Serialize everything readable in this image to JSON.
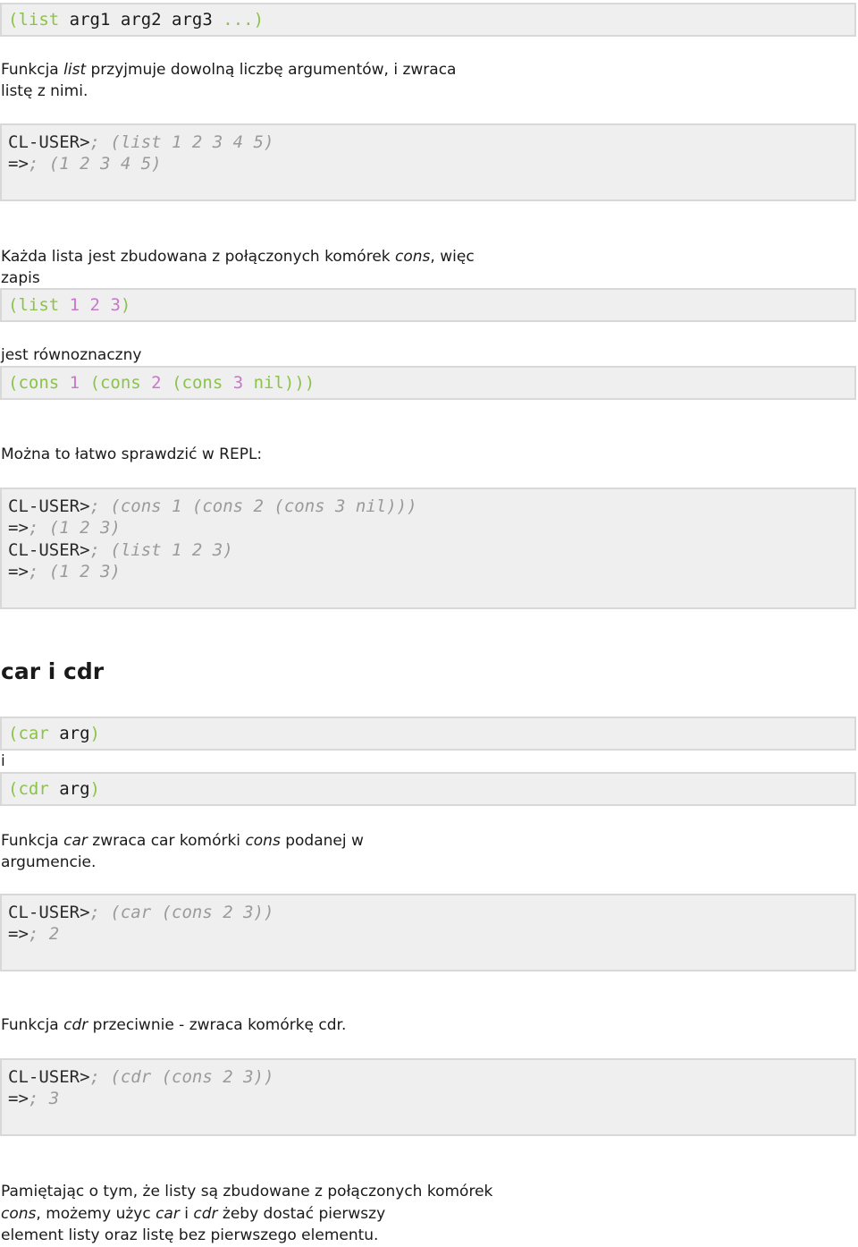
{
  "sig_list": {
    "open": "(",
    "fn": "list",
    "args": " arg1 arg2 arg3 ",
    "rest": "...",
    "close": ")"
  },
  "p1": {
    "a": "Funkcja ",
    "b": "list",
    "c": " przyjmuje dowolną liczbę argumentów, i zwraca",
    "d": "listę z nimi."
  },
  "repl1": {
    "prompt": "CL-USER>",
    "l1": "; (list 1 2 3 4 5)",
    "arrow": "=>",
    "l2": "; (1 2 3 4 5)"
  },
  "p2": {
    "a": "Każda lista jest zbudowana z połączonych komórek ",
    "b": "cons",
    "c": ", więc",
    "d": "zapis"
  },
  "ex_list": {
    "open": "(list ",
    "n1": "1",
    "s1": " ",
    "n2": "2",
    "s2": " ",
    "n3": "3",
    "close": ")"
  },
  "p3": "jest równoznaczny",
  "ex_cons": {
    "c1": "(cons ",
    "n1": "1",
    "c2": " (cons ",
    "n2": "2",
    "c3": " (cons ",
    "n3": "3",
    "c4": " nil)))"
  },
  "p4": "Można to łatwo sprawdzić w REPL:",
  "repl2": {
    "prompt1": "CL-USER>",
    "l1": "; (cons 1 (cons 2 (cons 3 nil)))",
    "arrow1": "=>",
    "l2": "; (1 2 3)",
    "prompt2": "CL-USER>",
    "l3": "; (list 1 2 3)",
    "arrow2": "=>",
    "l4": "; (1 2 3)"
  },
  "heading": "car i cdr",
  "sig_car": {
    "open": "(car ",
    "arg": "arg",
    "close": ")"
  },
  "conj": "i",
  "sig_cdr": {
    "open": "(cdr ",
    "arg": "arg",
    "close": ")"
  },
  "p5": {
    "a": "Funkcja ",
    "b": "car",
    "c": " zwraca car komórki ",
    "d": "cons",
    "e": " podanej w",
    "f": "argumencie."
  },
  "repl3": {
    "prompt": "CL-USER>",
    "l1": "; (car (cons 2 3))",
    "arrow": "=>",
    "l2": "; 2"
  },
  "p6": {
    "a": "Funkcja ",
    "b": "cdr",
    "c": " przeciwnie - zwraca komórkę cdr."
  },
  "repl4": {
    "prompt": "CL-USER>",
    "l1": "; (cdr (cons 2 3))",
    "arrow": "=>",
    "l2": "; 3"
  },
  "p7": {
    "a": "Pamiętając o tym, że listy są zbudowane z połączonych komórek",
    "b": "cons",
    "c": ", możemy użyc ",
    "d": "car",
    "e": " i ",
    "f": "cdr",
    "g": " żeby dostać pierwszy",
    "h": "element listy oraz listę bez pierwszego elementu."
  }
}
